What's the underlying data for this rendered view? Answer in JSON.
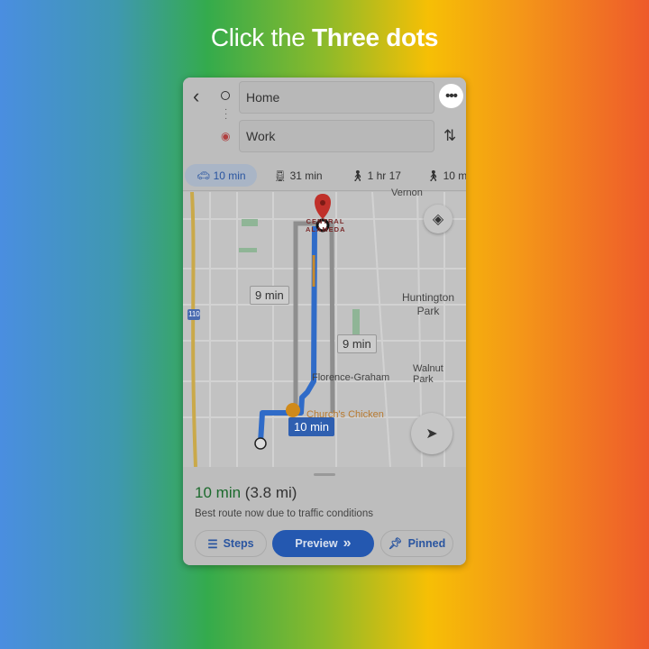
{
  "instruction": {
    "prefix": "Click the ",
    "emphasis": "Three dots"
  },
  "directions": {
    "origin": "Home",
    "destination": "Work"
  },
  "modes": [
    {
      "icon": "car-icon",
      "label": "10 min",
      "selected": true
    },
    {
      "icon": "transit-icon",
      "label": "31 min"
    },
    {
      "icon": "walk-icon",
      "label": "1 hr 17"
    },
    {
      "icon": "rideshare-icon",
      "label": "10 m"
    }
  ],
  "map": {
    "labels": {
      "vernon": "Vernon",
      "central": "CENTRAL ALAMEDA",
      "huntington": "Huntington Park",
      "walnut": "Walnut Park",
      "florence": "Florence-Graham",
      "churchs": "Church's Chicken",
      "highway": "110"
    },
    "alt_route_1": "9 min",
    "alt_route_2": "9 min",
    "main_route": "10 min",
    "colors": {
      "route": "#2f6bc8",
      "alt": "#8e8e8e",
      "destination": "#c0302a"
    }
  },
  "sheet": {
    "eta_number": "10",
    "eta_unit": "min",
    "distance": "(3.8 mi)",
    "note": "Best route now due to traffic conditions",
    "steps": "Steps",
    "preview": "Preview",
    "pinned": "Pinned"
  }
}
